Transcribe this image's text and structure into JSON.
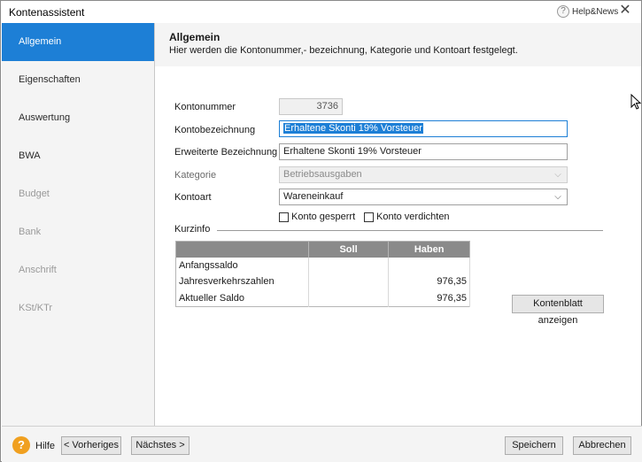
{
  "window": {
    "title": "Kontenassistent",
    "help_news": "Help&News"
  },
  "sidebar": {
    "items": [
      {
        "label": "Allgemein"
      },
      {
        "label": "Eigenschaften"
      },
      {
        "label": "Auswertung"
      },
      {
        "label": "BWA"
      },
      {
        "label": "Budget"
      },
      {
        "label": "Bank"
      },
      {
        "label": "Anschrift"
      },
      {
        "label": "KSt/KTr"
      }
    ],
    "active": "Allgemein"
  },
  "header": {
    "title": "Allgemein",
    "subtitle": "Hier werden die Kontonummer,- bezeichnung, Kategorie und Kontoart festgelegt."
  },
  "form": {
    "kontonummer": {
      "label": "Kontonummer",
      "value": "3736"
    },
    "kontobezeichnung": {
      "label": "Kontobezeichnung",
      "value": "Erhaltene Skonti 19% Vorsteuer"
    },
    "erweiterte": {
      "label": "Erweiterte Bezeichnung",
      "value": "Erhaltene Skonti 19% Vorsteuer"
    },
    "kategorie": {
      "label": "Kategorie",
      "value": "Betriebsausgaben"
    },
    "kontoart": {
      "label": "Kontoart",
      "value": "Wareneinkauf"
    },
    "konto_gesperrt": {
      "label": "Konto gesperrt",
      "checked": false
    },
    "konto_verdichten": {
      "label": "Konto verdichten",
      "checked": false
    }
  },
  "kurzinfo": {
    "label": "Kurzinfo",
    "columns": [
      "",
      "Soll",
      "Haben"
    ],
    "rows": [
      {
        "label": "Anfangssaldo",
        "soll": "",
        "haben": ""
      },
      {
        "label": "Jahresverkehrszahlen",
        "soll": "",
        "haben": "976,35"
      },
      {
        "label": "Aktueller Saldo",
        "soll": "",
        "haben": "976,35"
      }
    ],
    "kontenblatt_button": "Kontenblatt anzeigen"
  },
  "footer": {
    "help_label": "Hilfe",
    "prev_button": "< Vorheriges",
    "next_button": "Nächstes >",
    "save_button": "Speichern",
    "cancel_button": "Abbrechen"
  },
  "colors": {
    "accent": "#1d7fd6",
    "table_header": "#8a8a8a",
    "help_icon": "#f0a020"
  }
}
